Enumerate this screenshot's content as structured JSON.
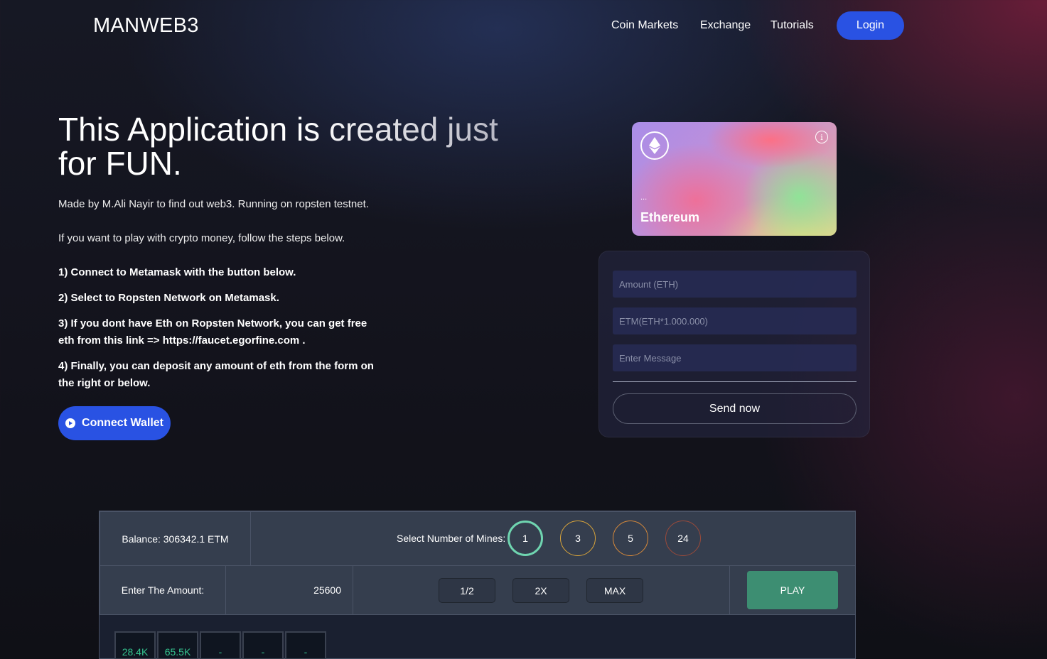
{
  "nav": {
    "brand": "MANWEB3",
    "links": [
      "Coin Markets",
      "Exchange",
      "Tutorials"
    ],
    "login": "Login"
  },
  "hero": {
    "title": "This Application is created just for FUN.",
    "subtitle": "Made by M.Ali Nayir to find out web3. Running on ropsten testnet.",
    "intro": "If you want to play with crypto money, follow the steps below.",
    "steps": [
      "1) Connect to Metamask with the button below.",
      "2) Select to Ropsten Network on Metamask.",
      "3) If you dont have Eth on Ropsten Network, you can get free eth from this link => https://faucet.egorfine.com .",
      "4) Finally, you can deposit any amount of eth from the form on the right or below."
    ],
    "connect_label": "Connect Wallet"
  },
  "card": {
    "address": "...",
    "network": "Ethereum",
    "info_glyph": "i",
    "logo_icon": "ethereum-icon"
  },
  "form": {
    "amount_placeholder": "Amount (ETH)",
    "etm_placeholder": "ETM(ETH*1.000.000)",
    "message_placeholder": "Enter Message",
    "send_label": "Send now"
  },
  "game": {
    "balance": "Balance: 306342.1 ETM",
    "mines_label": "Select Number of Mines:",
    "mines": [
      "1",
      "3",
      "5",
      "24"
    ],
    "mine_colors": [
      "#6fd5b0",
      "#d9a43a",
      "#d98a3a",
      "#9a4a3a"
    ],
    "amount_label": "Enter The Amount:",
    "amount_value": "25600",
    "multipliers": [
      "1/2",
      "2X",
      "MAX"
    ],
    "play_label": "PLAY",
    "history": [
      "28.4K",
      "65.5K",
      "-",
      "-",
      "-"
    ]
  },
  "colors": {
    "accent": "#2952e3",
    "play": "#3d8e72",
    "history_text": "#34c48f"
  }
}
